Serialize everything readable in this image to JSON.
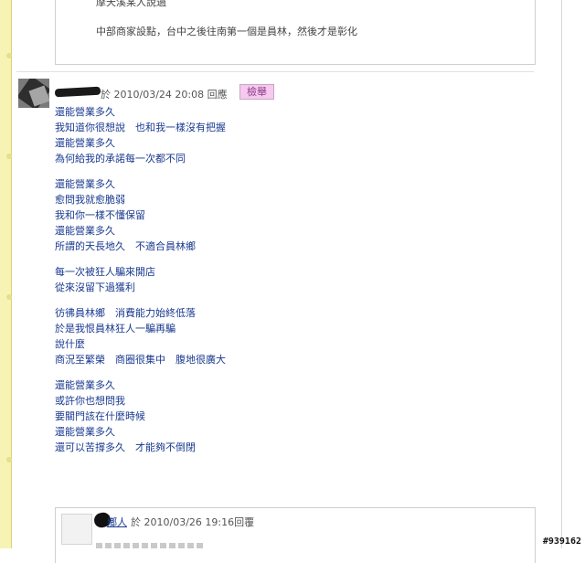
{
  "quoted_post": {
    "line1": "摩天溪某人說過",
    "line2": "中部商家設點，台中之後往南第一個是員林，然後才是彰化"
  },
  "post": {
    "meta": "於 2010/03/24 20:08",
    "reply_label": "回應",
    "report_label": "檢舉",
    "stanzas": [
      [
        "還能營業多久",
        "我知道你很想說　也和我一樣沒有把握",
        "還能營業多久",
        "為何給我的承諾每一次都不同"
      ],
      [
        "還能營業多久",
        "愈問我就愈脆弱",
        "我和你一樣不懂保留",
        "還能營業多久",
        "所謂的天長地久　不適合員林鄉"
      ],
      [
        "每一次被狂人騙來開店",
        "從來沒留下過獲利"
      ],
      [
        "彷彿員林鄉　消費能力始終低落",
        "於是我恨員林狂人一騙再騙",
        "說什麼",
        "商況至繁榮　商圈很集中　腹地很廣大"
      ],
      [
        "還能營業多久",
        "或許你也想問我",
        "要關門該在什麼時候",
        "還能營業多久",
        "還可以苦撐多久　才能夠不倒閉"
      ]
    ]
  },
  "reply": {
    "author": "鄉人",
    "meta": "於 2010/03/26 19:16回覆"
  },
  "watermark": "#939162",
  "colors": {
    "post_text": "#1a3a8f",
    "meta_text": "#555555",
    "report_bg": "#f7c9ee",
    "strip_bg": "#f6f3b5"
  }
}
